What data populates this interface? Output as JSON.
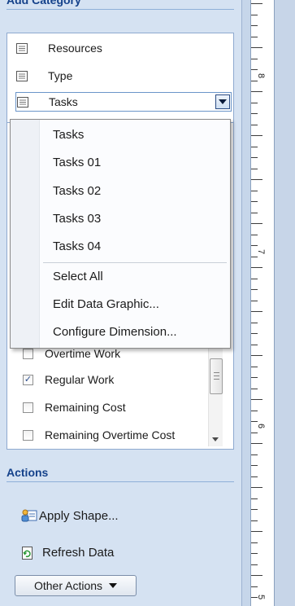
{
  "pane": {
    "add_category_header": "Add Category",
    "categories": [
      {
        "label": "Resources",
        "icon": "document-icon"
      },
      {
        "label": "Type",
        "icon": "document-icon"
      },
      {
        "label": "Tasks",
        "icon": "document-icon",
        "selected": true
      }
    ],
    "dropdown": {
      "items": [
        "Tasks",
        "Tasks 01",
        "Tasks 02",
        "Tasks 03",
        "Tasks 04"
      ],
      "commands": [
        "Select All",
        "Edit Data Graphic...",
        "Configure Dimension..."
      ]
    },
    "data_items": [
      {
        "label": "Overtime Work",
        "checked": false
      },
      {
        "label": "Regular Work",
        "checked": true
      },
      {
        "label": "Remaining Cost",
        "checked": false
      },
      {
        "label": "Remaining Overtime Cost",
        "checked": false
      }
    ],
    "actions_header": "Actions",
    "actions": [
      {
        "label": "Apply Shape...",
        "icon": "shape-icon"
      },
      {
        "label": "Refresh Data",
        "icon": "refresh-icon"
      }
    ],
    "other_actions_label": "Other Actions"
  },
  "ruler": {
    "labels": [
      "8",
      "7",
      "6",
      "5"
    ]
  },
  "colors": {
    "header": "#15428b",
    "pane_bg": "#d5e2f2",
    "accent": "#2b4c84"
  }
}
